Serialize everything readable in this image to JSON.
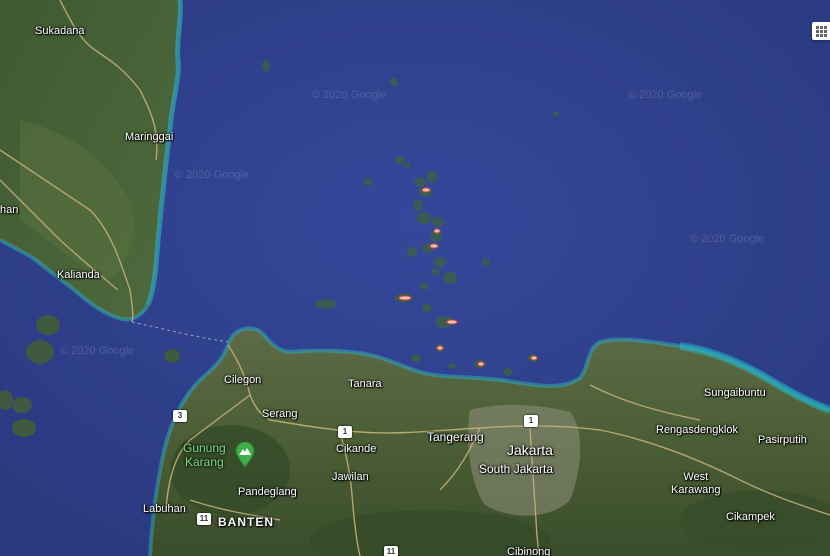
{
  "watermarks": [
    "© 2020 Google",
    "© 2020 Google",
    "© 2020 Google",
    "© 2020 Google",
    "© 2020 Google"
  ],
  "places": {
    "sukadana": "Sukadana",
    "maringgai": "Maringgai",
    "kalianda": "Kalianda",
    "han": "han",
    "cilegon": "Cilegon",
    "tanara": "Tanara",
    "serang": "Serang",
    "cikande": "Cikande",
    "jawilan": "Jawilan",
    "tangerang": "Tangerang",
    "jakarta": "Jakarta",
    "south_jakarta": "South Jakarta",
    "sungaibuntu": "Sungaibuntu",
    "rengasdengklok": "Rengasdengklok",
    "pasirputih": "Pasirputih",
    "west_karawang": "West\nKarawang",
    "cikampek": "Cikampek",
    "pandeglang": "Pandeglang",
    "labuhan": "Labuhan",
    "banten": "BANTEN",
    "cibinong": "Cibinong"
  },
  "poi": {
    "gunung_karang": "Gunung\nKarang",
    "icon": "mountain-icon"
  },
  "road_shields": {
    "s3": "3",
    "s1a": "1",
    "s1b": "1",
    "s11a": "11",
    "s11b": "11"
  },
  "colors": {
    "sea": "#2f3f8a",
    "land": "#4a5e38",
    "land_dark": "#3b4c2c",
    "coast": "#2fa7b8",
    "road": "#c9b37a"
  }
}
